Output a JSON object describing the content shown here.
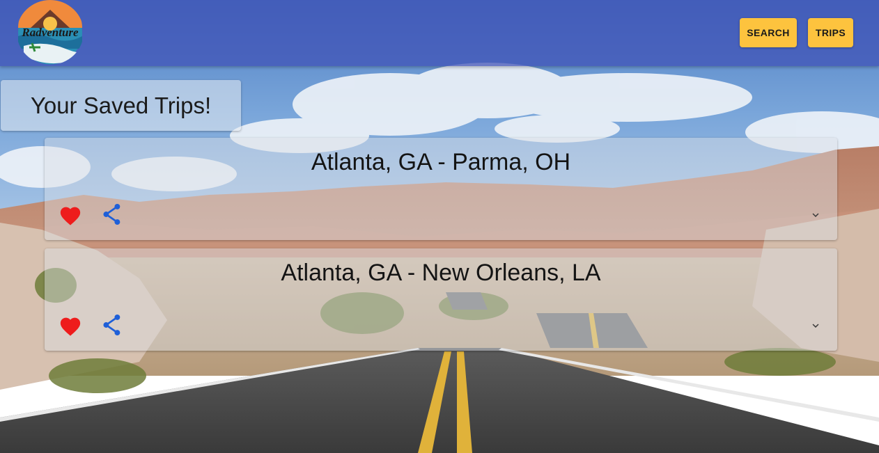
{
  "header": {
    "logo_text": "Radventure",
    "nav": [
      {
        "label": "SEARCH"
      },
      {
        "label": "TRIPS"
      }
    ],
    "background_color": "#3f51b5",
    "button_color": "#fdc33e"
  },
  "page": {
    "heading": "Your Saved Trips!"
  },
  "trips": [
    {
      "title": "Atlanta, GA - Parma, OH",
      "favorite": true,
      "icons": [
        "heart-icon",
        "share-icon",
        "chevron-down-icon"
      ]
    },
    {
      "title": "Atlanta, GA - New Orleans, LA",
      "favorite": true,
      "icons": [
        "heart-icon",
        "share-icon",
        "chevron-down-icon"
      ]
    }
  ],
  "colors": {
    "heart": "#ee1c1c",
    "share": "#1e5fd8"
  }
}
